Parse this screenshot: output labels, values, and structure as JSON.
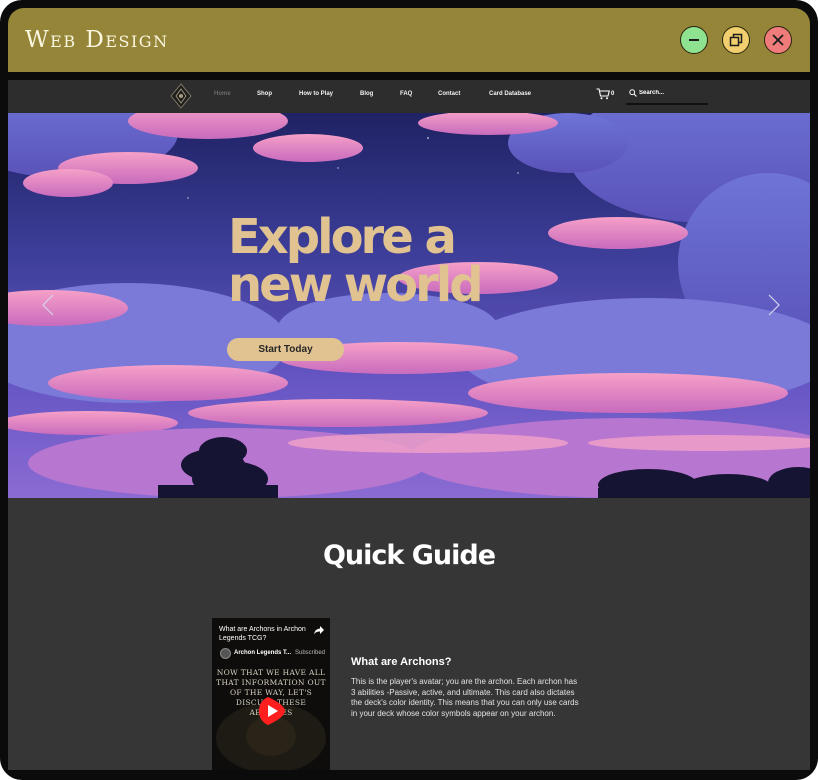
{
  "window": {
    "title": "Web Design",
    "minimize_icon": "minus-icon",
    "restore_icon": "restore-icon",
    "close_icon": "close-icon"
  },
  "nav": {
    "items": [
      {
        "label": "Home",
        "active": true
      },
      {
        "label": "Shop"
      },
      {
        "label": "How to Play"
      },
      {
        "label": "Blog"
      },
      {
        "label": "FAQ"
      },
      {
        "label": "Contact"
      },
      {
        "label": "Card Database"
      }
    ],
    "cart_count": "0",
    "search_placeholder": "Search..."
  },
  "hero": {
    "headline_line1": "Explore a",
    "headline_line2": "new world",
    "cta_label": "Start Today"
  },
  "guide": {
    "title": "Quick Guide",
    "video": {
      "title": "What are Archons in Archon Legends TCG?",
      "channel": "Archon Legends T...",
      "subscribed": "Subscribed",
      "overlay_text": "NOW THAT WE HAVE ALL THAT INFORMATION OUT OF THE WAY, LET'S DISCUSS THESE ABILITIES"
    },
    "section_heading": "What are Archons?",
    "section_body": "This is the player's avatar; you are the archon. Each archon has 3  abilities -Passive, active, and ultimate. This card also dictates the deck's color identity. This means that you can only use cards in your deck whose color symbols appear on your archon."
  },
  "colors": {
    "titlebar": "#958538",
    "accent_gold": "#e1c391",
    "page_bg": "#363636",
    "nav_bg": "#2d2d2d"
  }
}
